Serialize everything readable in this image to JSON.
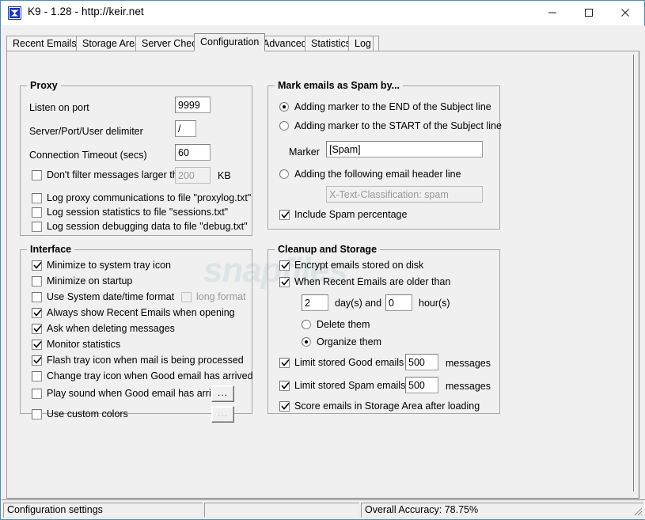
{
  "window": {
    "title": "K9 - 1.28 - http://keir.net",
    "icon": "k9-app-icon",
    "minimize_label": "–",
    "maximize_label": "□",
    "close_label": "✕"
  },
  "tabs": [
    {
      "label": "Recent Emails",
      "selected": false
    },
    {
      "label": "Storage Area",
      "selected": false
    },
    {
      "label": "Server Check",
      "selected": false
    },
    {
      "label": "Configuration",
      "selected": true
    },
    {
      "label": "Advanced",
      "selected": false
    },
    {
      "label": "Statistics",
      "selected": false
    },
    {
      "label": "Log",
      "selected": false
    }
  ],
  "watermark": "snapfiles",
  "proxy": {
    "title": "Proxy",
    "listen_on_port_label": "Listen on port",
    "listen_on_port_value": "9999",
    "delimiter_label": "Server/Port/User delimiter",
    "delimiter_value": "/",
    "timeout_label": "Connection Timeout (secs)",
    "timeout_value": "60",
    "dont_filter_label": "Don't filter messages larger than",
    "dont_filter_checked": false,
    "dont_filter_value": "200",
    "dont_filter_unit": "KB",
    "log_proxy_label": "Log proxy communications to file \"proxylog.txt\"",
    "log_proxy_checked": false,
    "log_stats_label": "Log session statistics to file \"sessions.txt\"",
    "log_stats_checked": false,
    "log_debug_label": "Log session debugging data to file \"debug.txt\"",
    "log_debug_checked": false
  },
  "spam": {
    "title": "Mark emails as Spam by...",
    "option_end_label": "Adding marker to the END of the Subject line",
    "option_end_selected": true,
    "option_start_label": "Adding marker to the START of the Subject line",
    "option_start_selected": false,
    "marker_label": "Marker",
    "marker_value": "[Spam]",
    "option_header_label": "Adding the following email header line",
    "option_header_selected": false,
    "header_value": "X-Text-Classification: spam",
    "include_percentage_label": "Include Spam percentage",
    "include_percentage_checked": true
  },
  "interface": {
    "title": "Interface",
    "items": [
      {
        "label": "Minimize to system tray icon",
        "checked": true,
        "disabled": false
      },
      {
        "label": "Minimize on startup",
        "checked": false,
        "disabled": false
      },
      {
        "label": "Use System date/time format",
        "checked": false,
        "disabled": false
      },
      {
        "label": "Always show Recent Emails when opening",
        "checked": true,
        "disabled": false
      },
      {
        "label": "Ask when deleting messages",
        "checked": true,
        "disabled": false
      },
      {
        "label": "Monitor statistics",
        "checked": true,
        "disabled": false
      },
      {
        "label": "Flash tray icon when mail is being processed",
        "checked": true,
        "disabled": false
      },
      {
        "label": "Change tray icon when Good email has arrived",
        "checked": false,
        "disabled": false
      },
      {
        "label": "Play sound when Good email has arrived",
        "checked": false,
        "disabled": false
      },
      {
        "label": "Use custom colors",
        "checked": false,
        "disabled": false
      }
    ],
    "long_format_label": "long format",
    "long_format_checked": false,
    "sound_browse_label": "...",
    "colors_browse_label": "..."
  },
  "cleanup": {
    "title": "Cleanup and Storage",
    "encrypt_label": "Encrypt emails stored on disk",
    "encrypt_checked": true,
    "older_than_label": "When Recent Emails are older than",
    "older_than_checked": true,
    "days_value": "2",
    "days_unit": "day(s) and",
    "hours_value": "0",
    "hours_unit": "hour(s)",
    "delete_them_label": "Delete them",
    "delete_them_selected": false,
    "organize_them_label": "Organize them",
    "organize_them_selected": true,
    "limit_good_label": "Limit stored Good emails to",
    "limit_good_checked": true,
    "limit_good_value": "500",
    "limit_good_unit": "messages",
    "limit_spam_label": "Limit stored Spam emails to",
    "limit_spam_checked": true,
    "limit_spam_value": "500",
    "limit_spam_unit": "messages",
    "score_label": "Score emails in Storage Area after loading",
    "score_checked": true
  },
  "statusbar": {
    "left": "Configuration settings",
    "middle": "",
    "right": "Overall Accuracy: 78.75%"
  }
}
